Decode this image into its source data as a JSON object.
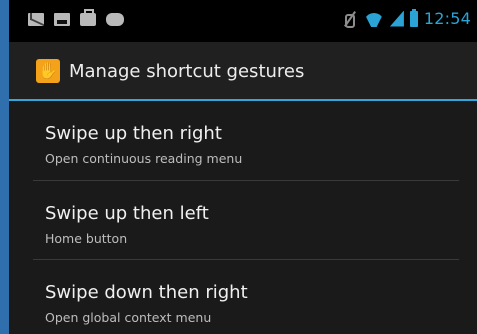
{
  "statusbar": {
    "notification_icons": [
      "mail-icon",
      "photo-icon",
      "shopping-bag-icon",
      "game-controller-icon"
    ],
    "right_icons": [
      "mute-icon",
      "wifi-icon",
      "signal-icon",
      "battery-icon"
    ],
    "time": "12:54",
    "accent_color": "#2aa3d6"
  },
  "actionbar": {
    "app_icon": "hand-gesture-icon",
    "title": "Manage shortcut gestures"
  },
  "list": {
    "items": [
      {
        "title": "Swipe up then right",
        "subtitle": "Open continuous reading menu"
      },
      {
        "title": "Swipe up then left",
        "subtitle": "Home button"
      },
      {
        "title": "Swipe down then right",
        "subtitle": "Open global context menu"
      }
    ]
  }
}
